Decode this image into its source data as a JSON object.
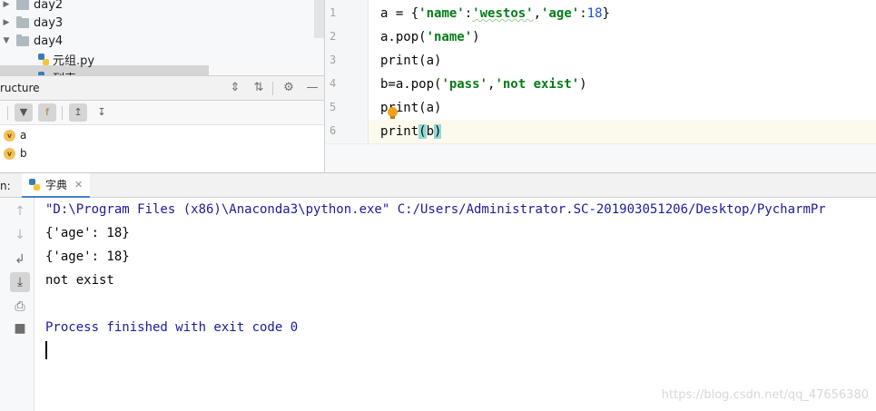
{
  "project_tree": {
    "items": [
      {
        "label": "day2",
        "type": "folder",
        "expanded": false
      },
      {
        "label": "day3",
        "type": "folder",
        "expanded": false
      },
      {
        "label": "day4",
        "type": "folder",
        "expanded": true
      },
      {
        "label": "元组.py",
        "type": "python-file"
      },
      {
        "label": "列表",
        "type": "python-file"
      }
    ]
  },
  "structure": {
    "title": "ructure",
    "items": [
      {
        "label": "a",
        "badge": "v"
      },
      {
        "label": "b",
        "badge": "v"
      }
    ],
    "toolbar_icons": [
      "sort-icon",
      "fields-icon",
      "navigate-up-icon",
      "navigate-down-icon"
    ],
    "header_icons": [
      "expand-all-icon",
      "collapse-all-icon",
      "gear-icon",
      "minimize-icon"
    ]
  },
  "editor": {
    "line_numbers": [
      "1",
      "2",
      "3",
      "4",
      "5",
      "6"
    ],
    "current_line": "6"
  },
  "run_panel": {
    "label": "n:",
    "tab_label": "字典",
    "console": {
      "command": "\"D:\\Program Files (x86)\\Anaconda3\\python.exe\" C:/Users/Administrator.SC-201903051206/Desktop/PycharmPr",
      "output": [
        "{'age': 18}",
        "{'age': 18}",
        "not exist"
      ],
      "exit_message": "Process finished with exit code 0"
    }
  },
  "watermark": "https://blog.csdn.net/qq_47656380",
  "colors": {
    "string": "#067d17",
    "number": "#1750eb",
    "console_system": "#1b1b9b",
    "tab_underline": "#4083c9",
    "current_line_bg": "#fcfaed",
    "paren_match": "#93d9d9"
  }
}
